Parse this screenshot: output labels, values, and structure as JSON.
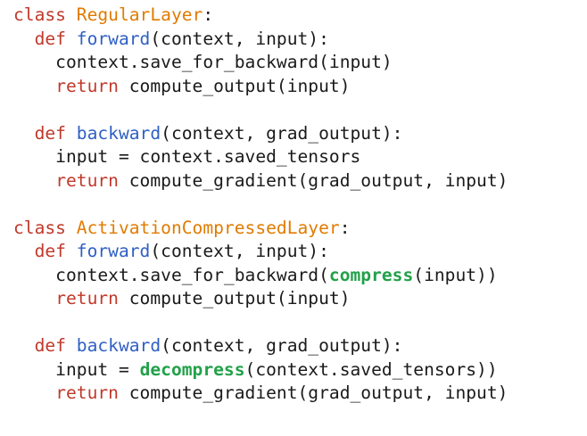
{
  "colors": {
    "keyword": "#c0392b",
    "class_name": "#e07b00",
    "function_name": "#2f5fc4",
    "highlight": "#22a14a",
    "text": "#1a1a1a",
    "background": "#ffffff"
  },
  "lines": [
    [
      {
        "t": "class",
        "c": "kw"
      },
      {
        "t": " ",
        "c": "plain"
      },
      {
        "t": "RegularLayer",
        "c": "cls"
      },
      {
        "t": ":",
        "c": "plain"
      }
    ],
    [
      {
        "t": "  ",
        "c": "plain"
      },
      {
        "t": "def",
        "c": "kw"
      },
      {
        "t": " ",
        "c": "plain"
      },
      {
        "t": "forward",
        "c": "fn"
      },
      {
        "t": "(context, input):",
        "c": "plain"
      }
    ],
    [
      {
        "t": "    context.save_for_backward(input)",
        "c": "plain"
      }
    ],
    [
      {
        "t": "    ",
        "c": "plain"
      },
      {
        "t": "return",
        "c": "kw"
      },
      {
        "t": " compute_output(input)",
        "c": "plain"
      }
    ],
    [],
    [
      {
        "t": "  ",
        "c": "plain"
      },
      {
        "t": "def",
        "c": "kw"
      },
      {
        "t": " ",
        "c": "plain"
      },
      {
        "t": "backward",
        "c": "fn"
      },
      {
        "t": "(context, grad_output):",
        "c": "plain"
      }
    ],
    [
      {
        "t": "    input = context.saved_tensors",
        "c": "plain"
      }
    ],
    [
      {
        "t": "    ",
        "c": "plain"
      },
      {
        "t": "return",
        "c": "kw"
      },
      {
        "t": " compute_gradient(grad_output, input)",
        "c": "plain"
      }
    ],
    [],
    [
      {
        "t": "class",
        "c": "kw"
      },
      {
        "t": " ",
        "c": "plain"
      },
      {
        "t": "ActivationCompressedLayer",
        "c": "cls"
      },
      {
        "t": ":",
        "c": "plain"
      }
    ],
    [
      {
        "t": "  ",
        "c": "plain"
      },
      {
        "t": "def",
        "c": "kw"
      },
      {
        "t": " ",
        "c": "plain"
      },
      {
        "t": "forward",
        "c": "fn"
      },
      {
        "t": "(context, input):",
        "c": "plain"
      }
    ],
    [
      {
        "t": "    context.save_for_backward(",
        "c": "plain"
      },
      {
        "t": "compress",
        "c": "hl"
      },
      {
        "t": "(input))",
        "c": "plain"
      }
    ],
    [
      {
        "t": "    ",
        "c": "plain"
      },
      {
        "t": "return",
        "c": "kw"
      },
      {
        "t": " compute_output(input)",
        "c": "plain"
      }
    ],
    [],
    [
      {
        "t": "  ",
        "c": "plain"
      },
      {
        "t": "def",
        "c": "kw"
      },
      {
        "t": " ",
        "c": "plain"
      },
      {
        "t": "backward",
        "c": "fn"
      },
      {
        "t": "(context, grad_output):",
        "c": "plain"
      }
    ],
    [
      {
        "t": "    input = ",
        "c": "plain"
      },
      {
        "t": "decompress",
        "c": "hl"
      },
      {
        "t": "(context.saved_tensors))",
        "c": "plain"
      }
    ],
    [
      {
        "t": "    ",
        "c": "plain"
      },
      {
        "t": "return",
        "c": "kw"
      },
      {
        "t": " compute_gradient(grad_output, input)",
        "c": "plain"
      }
    ]
  ]
}
